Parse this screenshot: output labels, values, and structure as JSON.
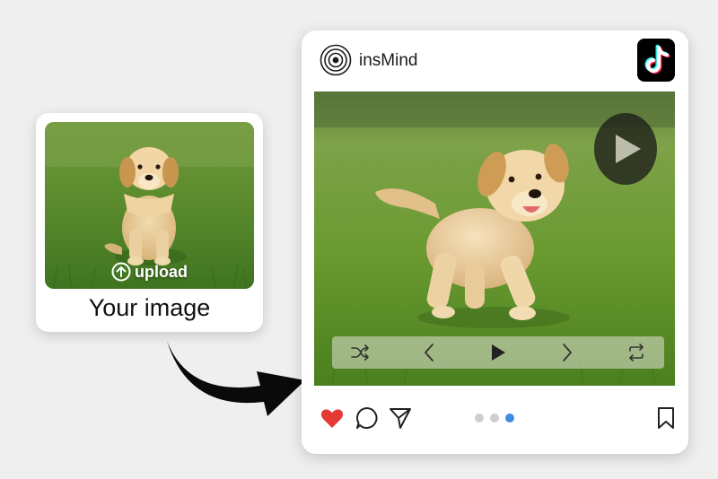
{
  "upload_card": {
    "overlay_label": "upload",
    "caption": "Your image"
  },
  "post": {
    "brand_name": "insMind",
    "pagination": {
      "total": 3,
      "active": 3
    }
  },
  "icons": {
    "brand_logo": "insmind-logo-icon",
    "tiktok": "tiktok-icon",
    "big_play": "play-icon",
    "controls": [
      "shuffle-icon",
      "previous-icon",
      "play-icon",
      "next-icon",
      "repeat-icon"
    ],
    "footer": [
      "heart-icon",
      "comment-icon",
      "share-icon",
      "bookmark-icon"
    ]
  },
  "colors": {
    "like": "#e53935",
    "active_dot": "#3d8ce6",
    "inactive_dot": "#cfcfcf",
    "tiktok_cyan": "#25f4ee",
    "tiktok_red": "#fe2c55"
  }
}
